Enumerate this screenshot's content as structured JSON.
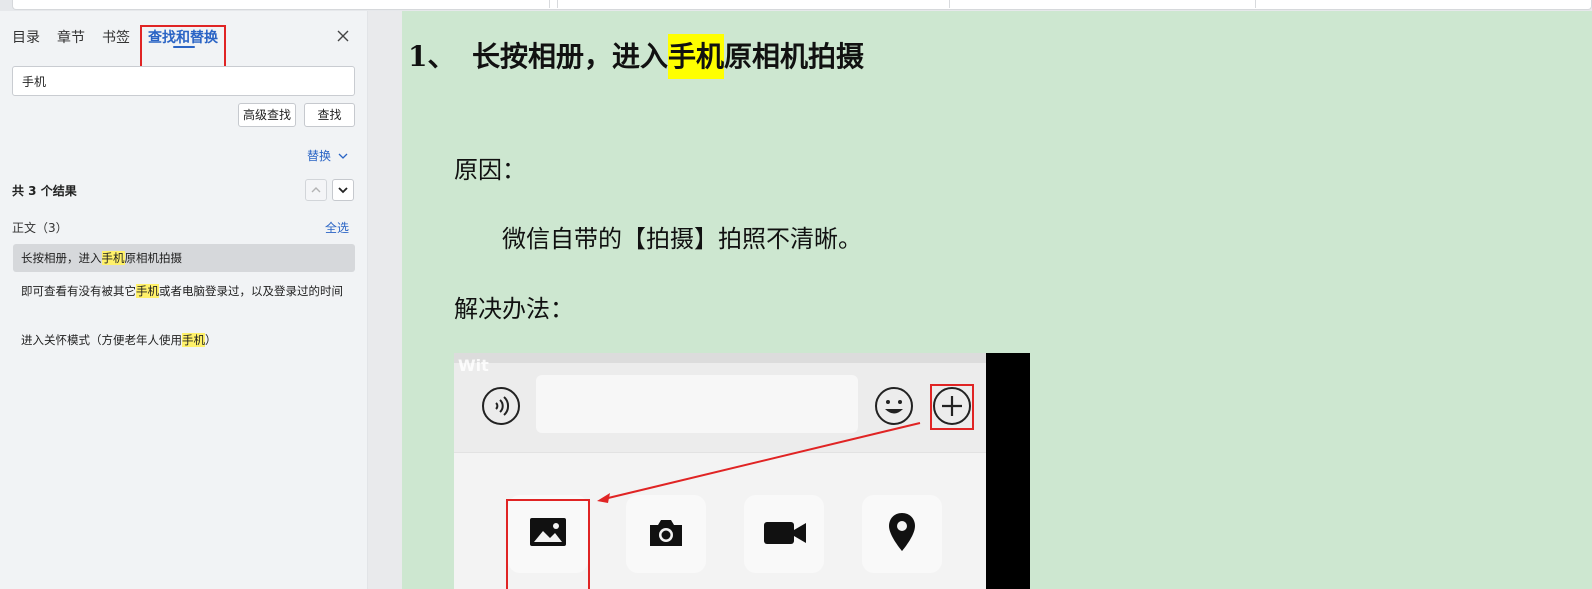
{
  "sidebar": {
    "tabs": [
      {
        "label": "目录"
      },
      {
        "label": "章节"
      },
      {
        "label": "书签"
      },
      {
        "label": "查找和替换"
      }
    ],
    "search_value": "手机",
    "advanced_label": "高级查找",
    "find_label": "查找",
    "replace_label": "替换",
    "result_count": "共 3 个结果",
    "section_label": "正文（3）",
    "select_all_label": "全选",
    "results": [
      {
        "before": "长按相册，进入",
        "match": "手机",
        "after": "原相机拍摄"
      },
      {
        "before": "即可查看有没有被其它",
        "match": "手机",
        "after": "或者电脑登录过，以及登录过的时间"
      },
      {
        "before": "进入关怀模式（方便老年人使用",
        "match": "手机",
        "after": "）"
      }
    ]
  },
  "document": {
    "heading_number": "1、",
    "heading_before": "长按相册，进入",
    "heading_match": "手机",
    "heading_after": "原相机拍摄",
    "reason_label": "原因：",
    "reason_text": "微信自带的【拍摄】拍照不清晰。",
    "solution_label": "解决办法：",
    "figure_watermark": "Wit"
  },
  "icons": {
    "close": "close-icon",
    "chevron_down": "chevron-down-icon",
    "chevron_up": "chevron-up-icon",
    "voice": "voice-icon",
    "emoji": "emoji-icon",
    "plus": "plus-icon",
    "photo": "photo-icon",
    "camera": "camera-icon",
    "video": "video-icon",
    "location": "location-icon"
  },
  "colors": {
    "accent": "#2a64c5",
    "highlight": "#fff16a",
    "page_bg": "#cde7d0",
    "annotation_red": "#e02424"
  }
}
